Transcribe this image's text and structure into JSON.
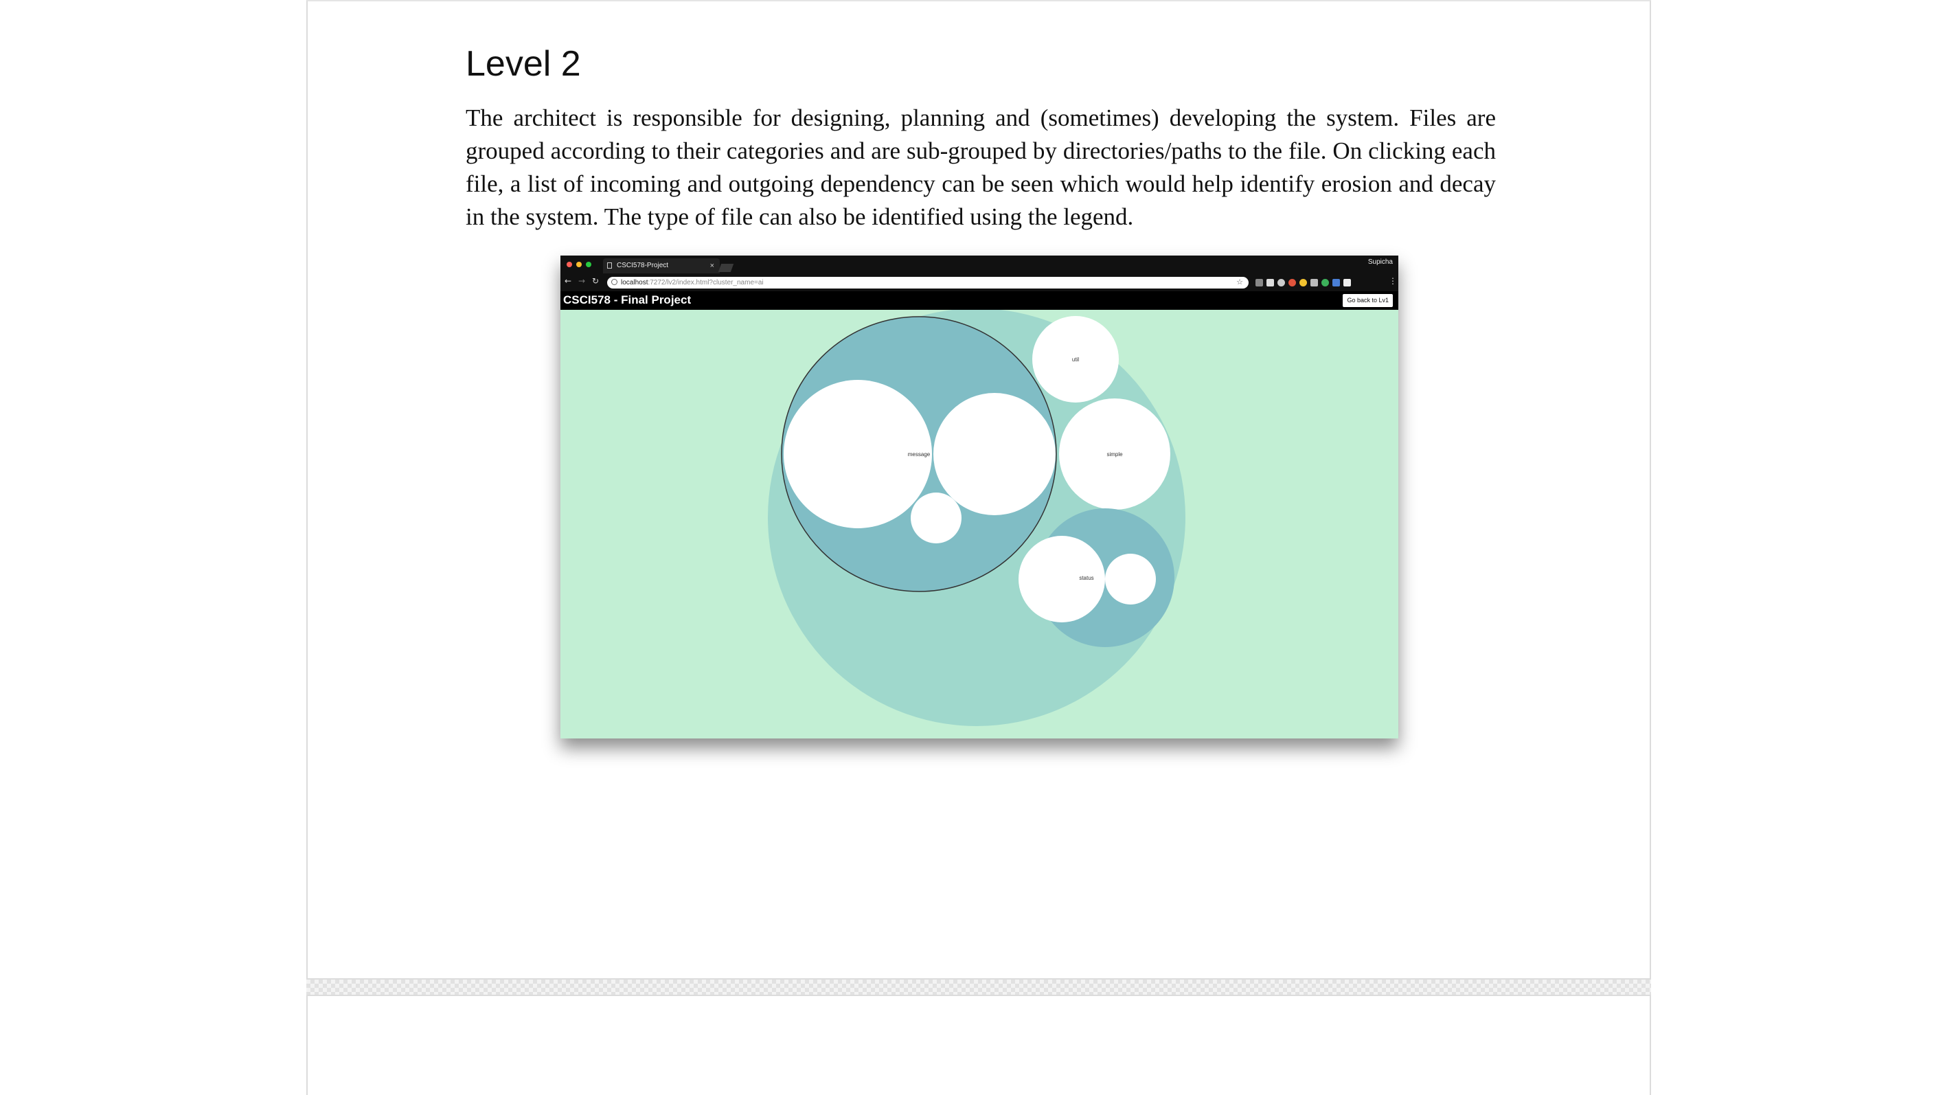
{
  "document": {
    "heading": "Level 2",
    "paragraph": "The architect is responsible for designing, planning and (sometimes) developing the system. Files are grouped according to their categories and are sub-grouped by directories/paths to the file. On clicking each file, a list of incoming and outgoing dependency can be seen which would help identify erosion and decay in the system. The type of file can also be identified using the legend."
  },
  "embedded_screenshot": {
    "browser": {
      "tab_title": "CSCI578-Project",
      "tab_close": "×",
      "profile_name": "Supicha",
      "url_host": "localhost",
      "url_path": ":7272/lv2/index.html?cluster_name=ai",
      "back_glyph": "←",
      "forward_glyph": "→",
      "reload_glyph": "↻",
      "star_glyph": "☆",
      "menu_glyph": "⋮"
    },
    "app": {
      "title": "CSCI578 - Final Project",
      "back_button_label": "Go back to Lv1"
    },
    "clusters": {
      "cluster_1": "message",
      "cluster_2": "util",
      "cluster_3": "simple",
      "cluster_4": "status"
    },
    "colors": {
      "background": "#c2efd4",
      "outer_circle": "#9fd8cc",
      "group_circle": "#80bdc5",
      "leaf_circle": "#ffffff"
    }
  }
}
